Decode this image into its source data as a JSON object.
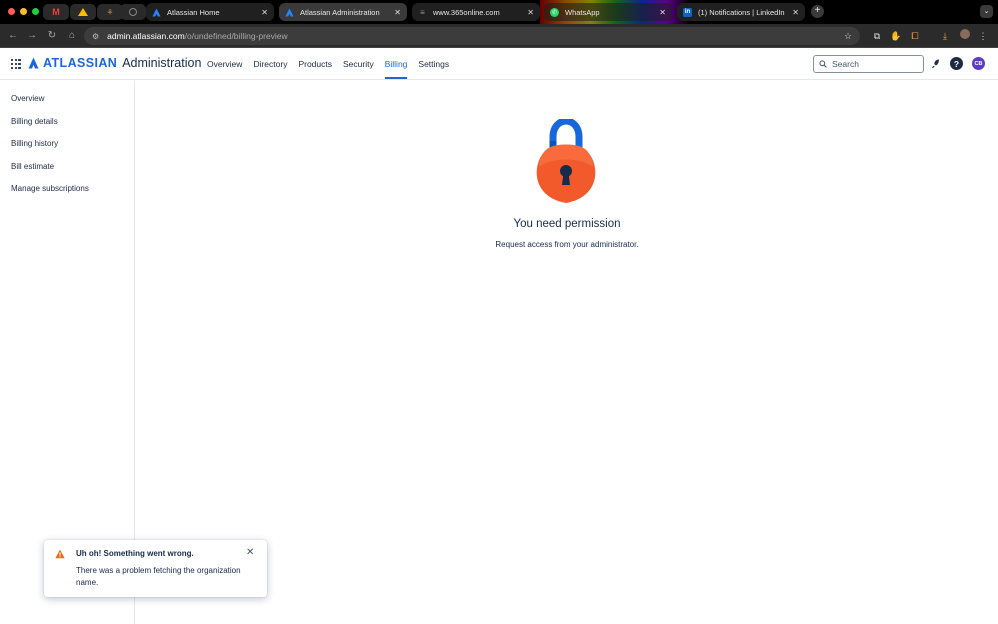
{
  "browser": {
    "tabs": [
      {
        "title": "Atlassian Home",
        "active": false
      },
      {
        "title": "Atlassian Administration",
        "active": true
      },
      {
        "title": "www.365online.com",
        "active": false
      },
      {
        "title": "WhatsApp",
        "active": false
      },
      {
        "title": "(1) Notifications | LinkedIn",
        "active": false
      }
    ],
    "url_host": "admin.atlassian.com",
    "url_path": "/o/undefined/billing-preview"
  },
  "header": {
    "brand": "ATLASSIAN",
    "product": "Administration",
    "nav": [
      "Overview",
      "Directory",
      "Products",
      "Security",
      "Billing",
      "Settings"
    ],
    "active_nav": "Billing",
    "search_placeholder": "Search",
    "avatar_initials": "CB",
    "help_label": "?"
  },
  "sidebar": {
    "items": [
      "Overview",
      "Billing details",
      "Billing history",
      "Bill estimate",
      "Manage subscriptions"
    ]
  },
  "main": {
    "title": "You need permission",
    "subtitle": "Request access from your administrator."
  },
  "flag": {
    "title": "Uh oh! Something went wrong.",
    "description": "There was a problem fetching the organization name."
  },
  "colors": {
    "brand_blue": "#1868db",
    "text_dark": "#172b4d",
    "lock_body": "#f25a2c",
    "lock_shackle": "#1868db",
    "warning": "#e56910",
    "avatar": "#5b3cc4"
  }
}
